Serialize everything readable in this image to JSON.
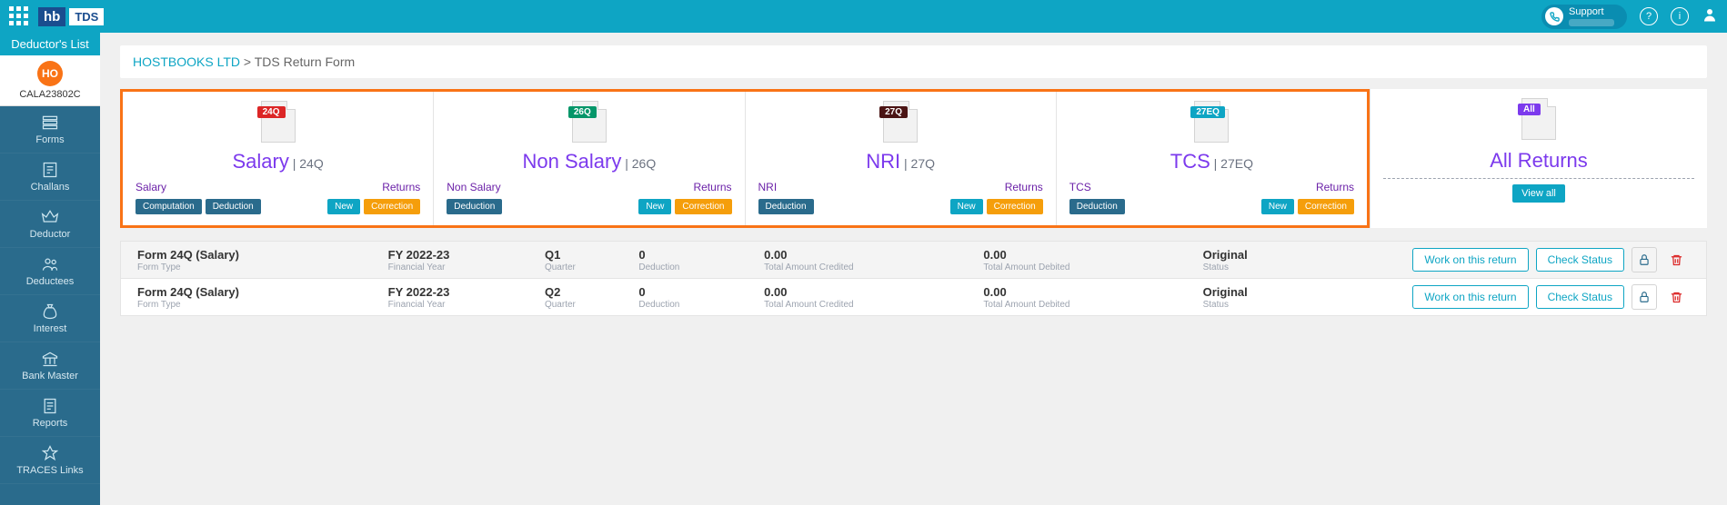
{
  "topbar": {
    "logo_hb": "hb",
    "logo_tds": "TDS",
    "support_label": "Support"
  },
  "sidebar": {
    "header": "Deductor's List",
    "avatar_initials": "HO",
    "deductor_id": "CALA23802C",
    "items": [
      {
        "label": "Forms"
      },
      {
        "label": "Challans"
      },
      {
        "label": "Deductor"
      },
      {
        "label": "Deductees"
      },
      {
        "label": "Interest"
      },
      {
        "label": "Bank Master"
      },
      {
        "label": "Reports"
      },
      {
        "label": "TRACES Links"
      }
    ]
  },
  "breadcrumb": {
    "a": "HOSTBOOKS LTD",
    "sep": ">",
    "b": "TDS Return Form"
  },
  "cards": {
    "salary": {
      "tag": "24Q",
      "title": "Salary",
      "sub": " | 24Q",
      "left": "Salary",
      "right": "Returns",
      "b1": "Computation",
      "b2": "Deduction",
      "b3": "New",
      "b4": "Correction"
    },
    "nonsalary": {
      "tag": "26Q",
      "title": "Non Salary",
      "sub": " | 26Q",
      "left": "Non Salary",
      "right": "Returns",
      "b1": "Deduction",
      "b3": "New",
      "b4": "Correction"
    },
    "nri": {
      "tag": "27Q",
      "title": "NRI",
      "sub": " | 27Q",
      "left": "NRI",
      "right": "Returns",
      "b1": "Deduction",
      "b3": "New",
      "b4": "Correction"
    },
    "tcs": {
      "tag": "27EQ",
      "title": "TCS",
      "sub": " | 27EQ",
      "left": "TCS",
      "right": "Returns",
      "b1": "Deduction",
      "b3": "New",
      "b4": "Correction"
    },
    "all": {
      "tag": "All",
      "title": "All Returns",
      "viewall": "View all"
    }
  },
  "table": {
    "labels": {
      "formtype": "Form Type",
      "fy": "Financial Year",
      "q": "Quarter",
      "ded": "Deduction",
      "cred": "Total Amount Credited",
      "deb": "Total Amount Debited",
      "status": "Status"
    },
    "rows": [
      {
        "formtype": "Form 24Q (Salary)",
        "fy": "FY 2022-23",
        "q": "Q1",
        "ded": "0",
        "cred": "0.00",
        "deb": "0.00",
        "status": "Original"
      },
      {
        "formtype": "Form 24Q (Salary)",
        "fy": "FY 2022-23",
        "q": "Q2",
        "ded": "0",
        "cred": "0.00",
        "deb": "0.00",
        "status": "Original"
      }
    ],
    "actions": {
      "work": "Work on this return",
      "check": "Check Status"
    }
  }
}
